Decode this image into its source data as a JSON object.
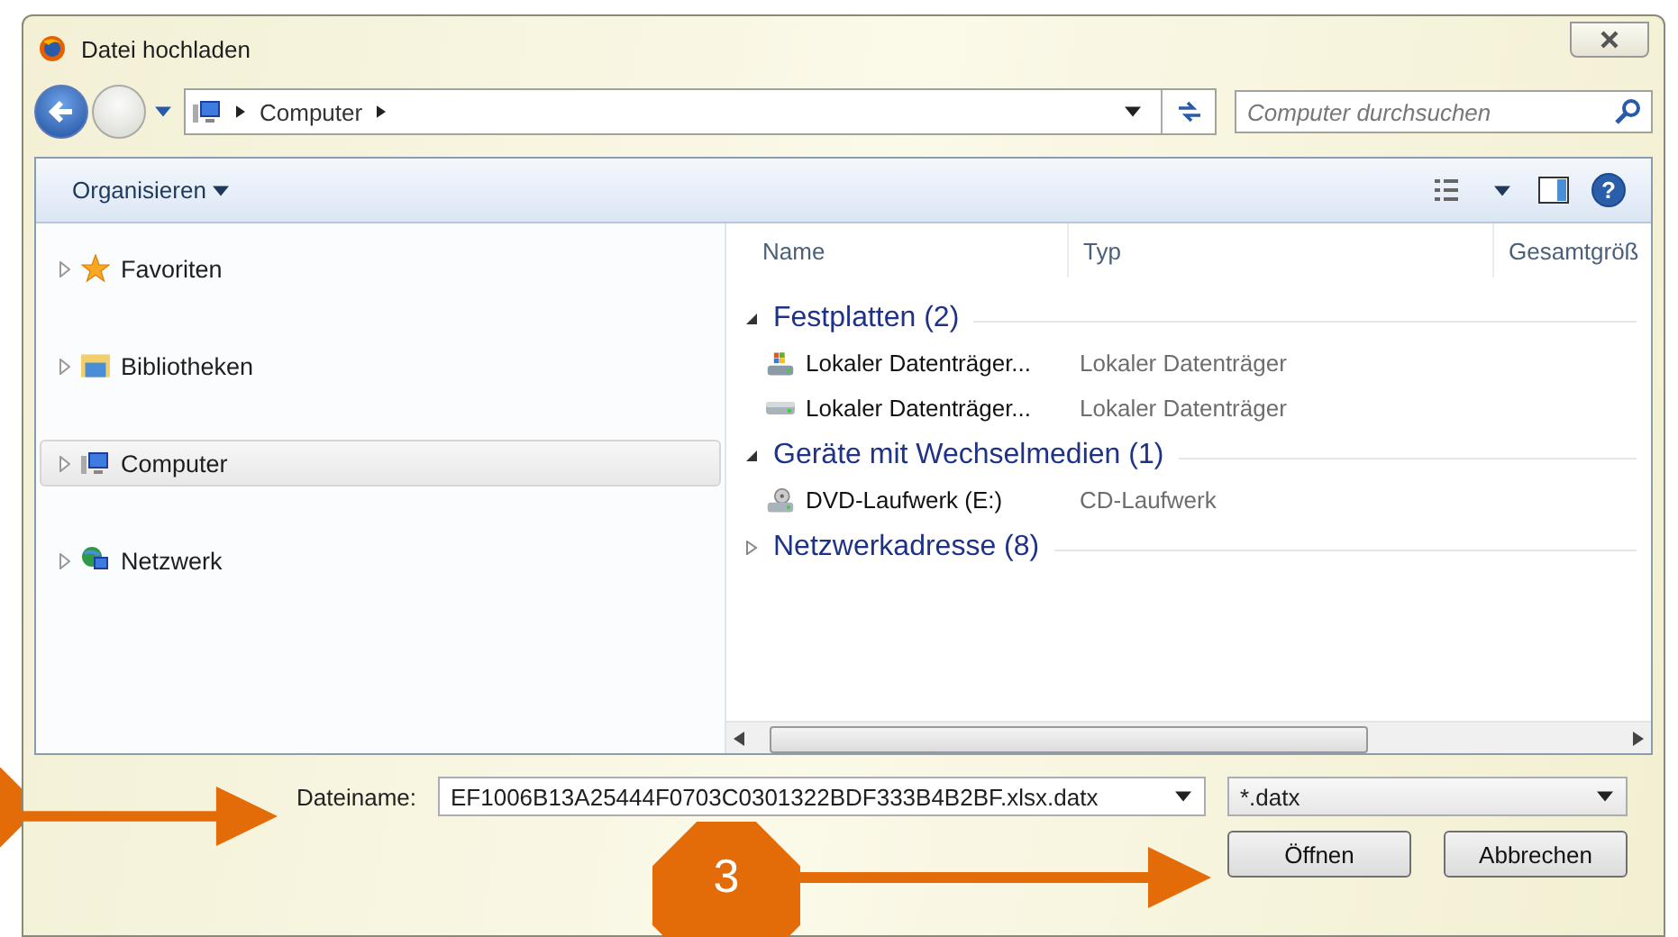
{
  "window": {
    "title": "Datei hochladen"
  },
  "address": {
    "path": [
      "Computer"
    ]
  },
  "search": {
    "placeholder": "Computer durchsuchen"
  },
  "toolbar": {
    "organize": "Organisieren",
    "help": "?"
  },
  "sidebar": {
    "items": [
      {
        "label": "Favoriten",
        "kind": "star",
        "selected": false
      },
      {
        "label": "Bibliotheken",
        "kind": "library",
        "selected": false
      },
      {
        "label": "Computer",
        "kind": "computer",
        "selected": true
      },
      {
        "label": "Netzwerk",
        "kind": "network",
        "selected": false
      }
    ]
  },
  "columns": [
    "Name",
    "Typ",
    "Gesamtgröß"
  ],
  "groups": [
    {
      "title": "Festplatten (2)",
      "expanded": true,
      "items": [
        {
          "name": "Lokaler Datenträger...",
          "type": "Lokaler Datenträger",
          "kind": "system-drive"
        },
        {
          "name": "Lokaler Datenträger...",
          "type": "Lokaler Datenträger",
          "kind": "drive"
        }
      ]
    },
    {
      "title": "Geräte mit Wechselmedien (1)",
      "expanded": true,
      "items": [
        {
          "name": "DVD-Laufwerk (E:)",
          "type": "CD-Laufwerk",
          "kind": "dvd"
        }
      ]
    },
    {
      "title": "Netzwerkadresse (8)",
      "expanded": false
    }
  ],
  "file": {
    "label": "Dateiname:",
    "value": "EF1006B13A25444F0703C0301322BDF333B4B2BF.xlsx.datx",
    "filter": "*.datx"
  },
  "buttons": [
    "Öffnen",
    "Abbrechen"
  ],
  "callouts": [
    {
      "number": "3"
    }
  ]
}
